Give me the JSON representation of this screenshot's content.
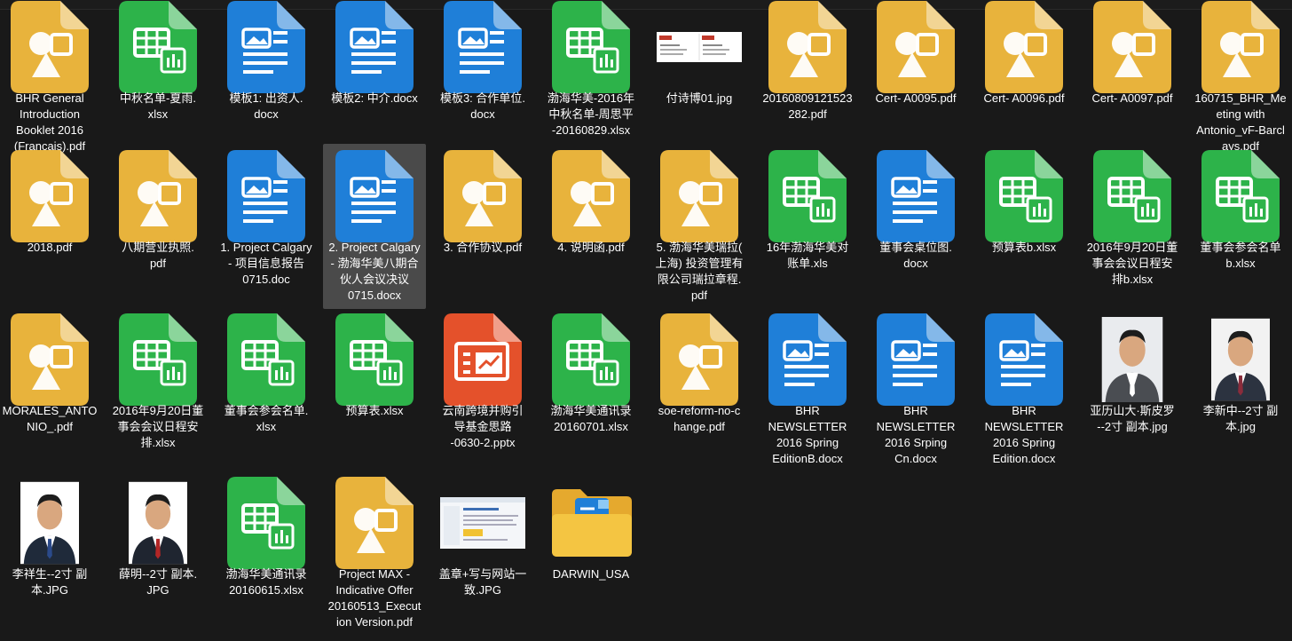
{
  "items": [
    {
      "label": "BHR General\nIntroduction\nBooklet 2016\n(Francais).pdf",
      "type": "pdf"
    },
    {
      "label": "中秋名单-夏雨.\nxlsx",
      "type": "xlsx"
    },
    {
      "label": "模板1: 出资人.\ndocx",
      "type": "docx"
    },
    {
      "label": "模板2: 中介.docx",
      "type": "docx"
    },
    {
      "label": "模板3: 合作单位.\ndocx",
      "type": "docx"
    },
    {
      "label": "渤海华美-2016年\n中秋名单-周思平\n-20160829.xlsx",
      "type": "xlsx"
    },
    {
      "label": "付诗博01.jpg",
      "type": "jpg-card"
    },
    {
      "label": "20160809121523\n282.pdf",
      "type": "pdf"
    },
    {
      "label": "Cert- A0095.pdf",
      "type": "pdf"
    },
    {
      "label": "Cert- A0096.pdf",
      "type": "pdf"
    },
    {
      "label": "Cert- A0097.pdf",
      "type": "pdf"
    },
    {
      "label": "160715_BHR_Me\neting with\nAntonio_vF-Barcl\nays.pdf",
      "type": "pdf"
    },
    {
      "label": "2018.pdf",
      "type": "pdf"
    },
    {
      "label": "八期营业执照.\npdf",
      "type": "pdf"
    },
    {
      "label": "1. Project Calgary\n- 项目信息报告\n0715.doc",
      "type": "docx"
    },
    {
      "label": "2. Project Calgary\n- 渤海华美八期合\n伙人会议决议\n0715.docx",
      "type": "docx",
      "selected": true
    },
    {
      "label": "3. 合作协议.pdf",
      "type": "pdf"
    },
    {
      "label": "4. 说明函.pdf",
      "type": "pdf"
    },
    {
      "label": "5. 渤海华美瑞拉(\n上海) 投资管理有\n限公司瑞拉章程.\npdf",
      "type": "pdf"
    },
    {
      "label": "16年渤海华美对\n账单.xls",
      "type": "xlsx"
    },
    {
      "label": "董事会桌位图.\ndocx",
      "type": "docx"
    },
    {
      "label": "预算表b.xlsx",
      "type": "xlsx"
    },
    {
      "label": "2016年9月20日董\n事会会议日程安\n排b.xlsx",
      "type": "xlsx"
    },
    {
      "label": "董事会参会名单\nb.xlsx",
      "type": "xlsx"
    },
    {
      "label": "MORALES_ANTO\nNIO_.pdf",
      "type": "pdf"
    },
    {
      "label": "2016年9月20日董\n事会会议日程安\n排.xlsx",
      "type": "xlsx"
    },
    {
      "label": "董事会参会名单.\nxlsx",
      "type": "xlsx"
    },
    {
      "label": "预算表.xlsx",
      "type": "xlsx"
    },
    {
      "label": "云南跨境并购引\n导基金思路\n-0630-2.pptx",
      "type": "pptx"
    },
    {
      "label": "渤海华美通讯录\n20160701.xlsx",
      "type": "xlsx"
    },
    {
      "label": "soe-reform-no-c\nhange.pdf",
      "type": "pdf"
    },
    {
      "label": "BHR\nNEWSLETTER\n2016 Spring\nEditionB.docx",
      "type": "docx"
    },
    {
      "label": "BHR\nNEWSLETTER\n2016 Srping\nCn.docx",
      "type": "docx"
    },
    {
      "label": "BHR\nNEWSLETTER\n2016 Spring\nEdition.docx",
      "type": "docx"
    },
    {
      "label": "亚历山大·斯皮罗\n--2寸 副本.jpg",
      "type": "photo-a"
    },
    {
      "label": "李新中--2寸 副\n本.jpg",
      "type": "photo-b"
    },
    {
      "label": "李祥生--2寸 副\n本.JPG",
      "type": "photo-c"
    },
    {
      "label": "薛明--2寸 副本.\nJPG",
      "type": "photo-d"
    },
    {
      "label": "渤海华美通讯录\n20160615.xlsx",
      "type": "xlsx"
    },
    {
      "label": "Project MAX -\nIndicative Offer\n20160513_Execut\nion Version.pdf",
      "type": "pdf"
    },
    {
      "label": "盖章+写与网站一\n致.JPG",
      "type": "jpg-web"
    },
    {
      "label": "DARWIN_USA",
      "type": "folder"
    }
  ],
  "colors": {
    "background": "#191919",
    "pdf": "#E8B33C",
    "xlsx": "#2DB34A",
    "docx": "#1F7FD8",
    "pptx": "#E4512B",
    "folder": "#F4C542",
    "selection": "#4a4a4a"
  }
}
